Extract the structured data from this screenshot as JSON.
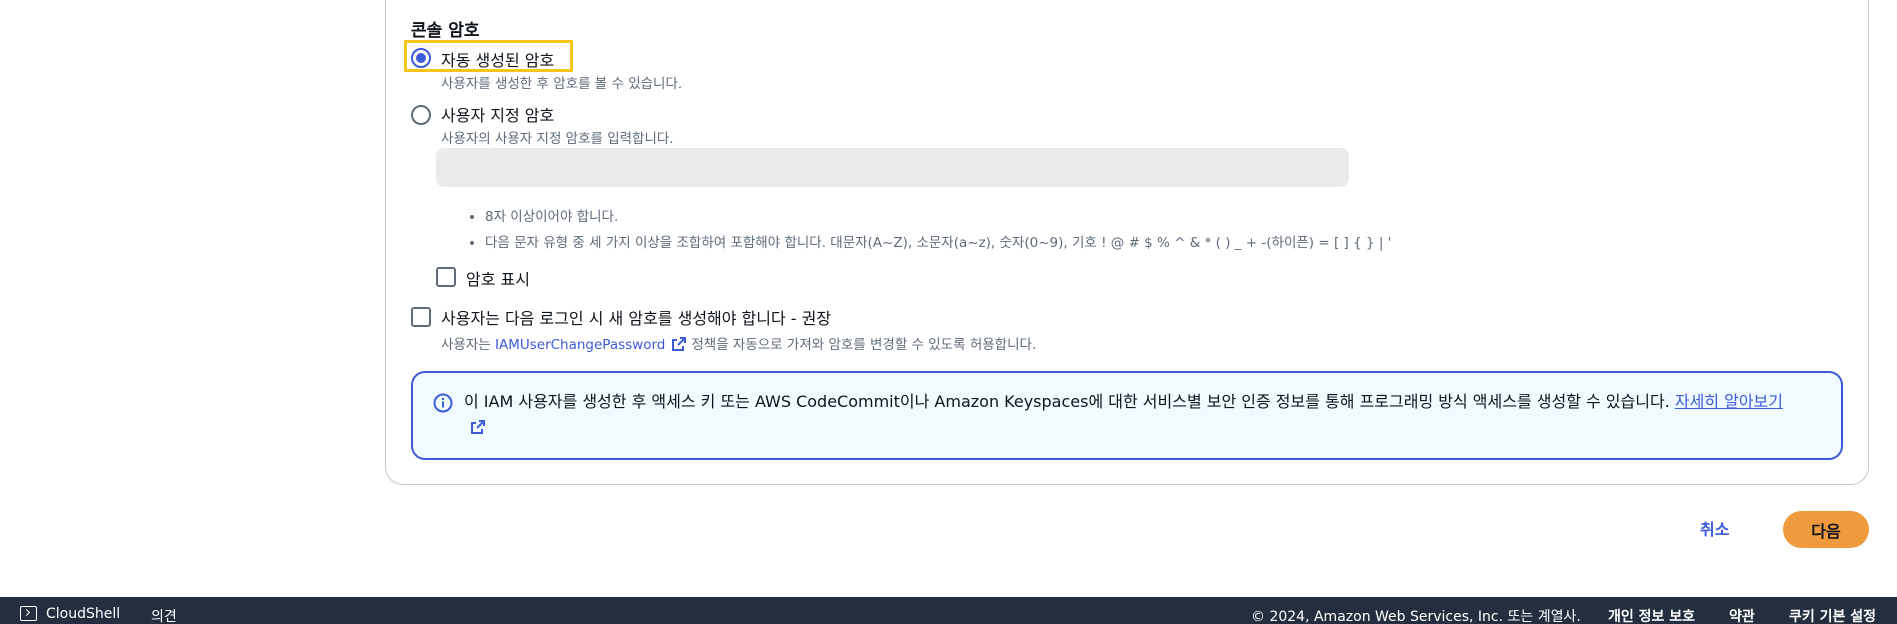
{
  "section": {
    "title": "콘솔 암호"
  },
  "options": {
    "auto": {
      "label": "자동 생성된 암호",
      "desc": "사용자를 생성한 후 암호를 볼 수 있습니다."
    },
    "custom": {
      "label": "사용자 지정 암호",
      "desc": "사용자의 사용자 지정 암호를 입력합니다."
    }
  },
  "password_input": {
    "value": "",
    "placeholder": ""
  },
  "rules": [
    "8자 이상이어야 합니다.",
    "다음 문자 유형 중 세 가지 이상을 조합하여 포함해야 합니다. 대문자(A~Z), 소문자(a~z), 숫자(0~9), 기호 ! @ # $ % ^ & * ( ) _ + -(하이픈) = [ ] { } | '"
  ],
  "show_password": {
    "label": "암호 표시"
  },
  "must_change": {
    "label": "사용자는 다음 로그인 시 새 암호를 생성해야 합니다 - 권장",
    "desc_prefix": "사용자는",
    "policy_link": "IAMUserChangePassword",
    "desc_suffix": "정책을 자동으로 가져와 암호를 변경할 수 있도록 허용합니다."
  },
  "info": {
    "text": "이 IAM 사용자를 생성한 후 액세스 키 또는 AWS CodeCommit이나 Amazon Keyspaces에 대한 서비스별 보안 인증 정보를 통해 프로그래밍 방식 액세스를 생성할 수 있습니다.",
    "link": "자세히 알아보기"
  },
  "actions": {
    "cancel": "취소",
    "next": "다음"
  },
  "footer": {
    "cloudshell": "CloudShell",
    "feedback": "의견",
    "copyright": "© 2024, Amazon Web Services, Inc. 또는 계열사.",
    "privacy": "개인 정보 보호",
    "terms": "약관",
    "cookies": "쿠키 기본 설정"
  },
  "colors": {
    "accent": "#3d5ad8",
    "primary_button": "#ee9a3d",
    "highlight": "#f5c518",
    "footer_bg": "#232f3e"
  }
}
